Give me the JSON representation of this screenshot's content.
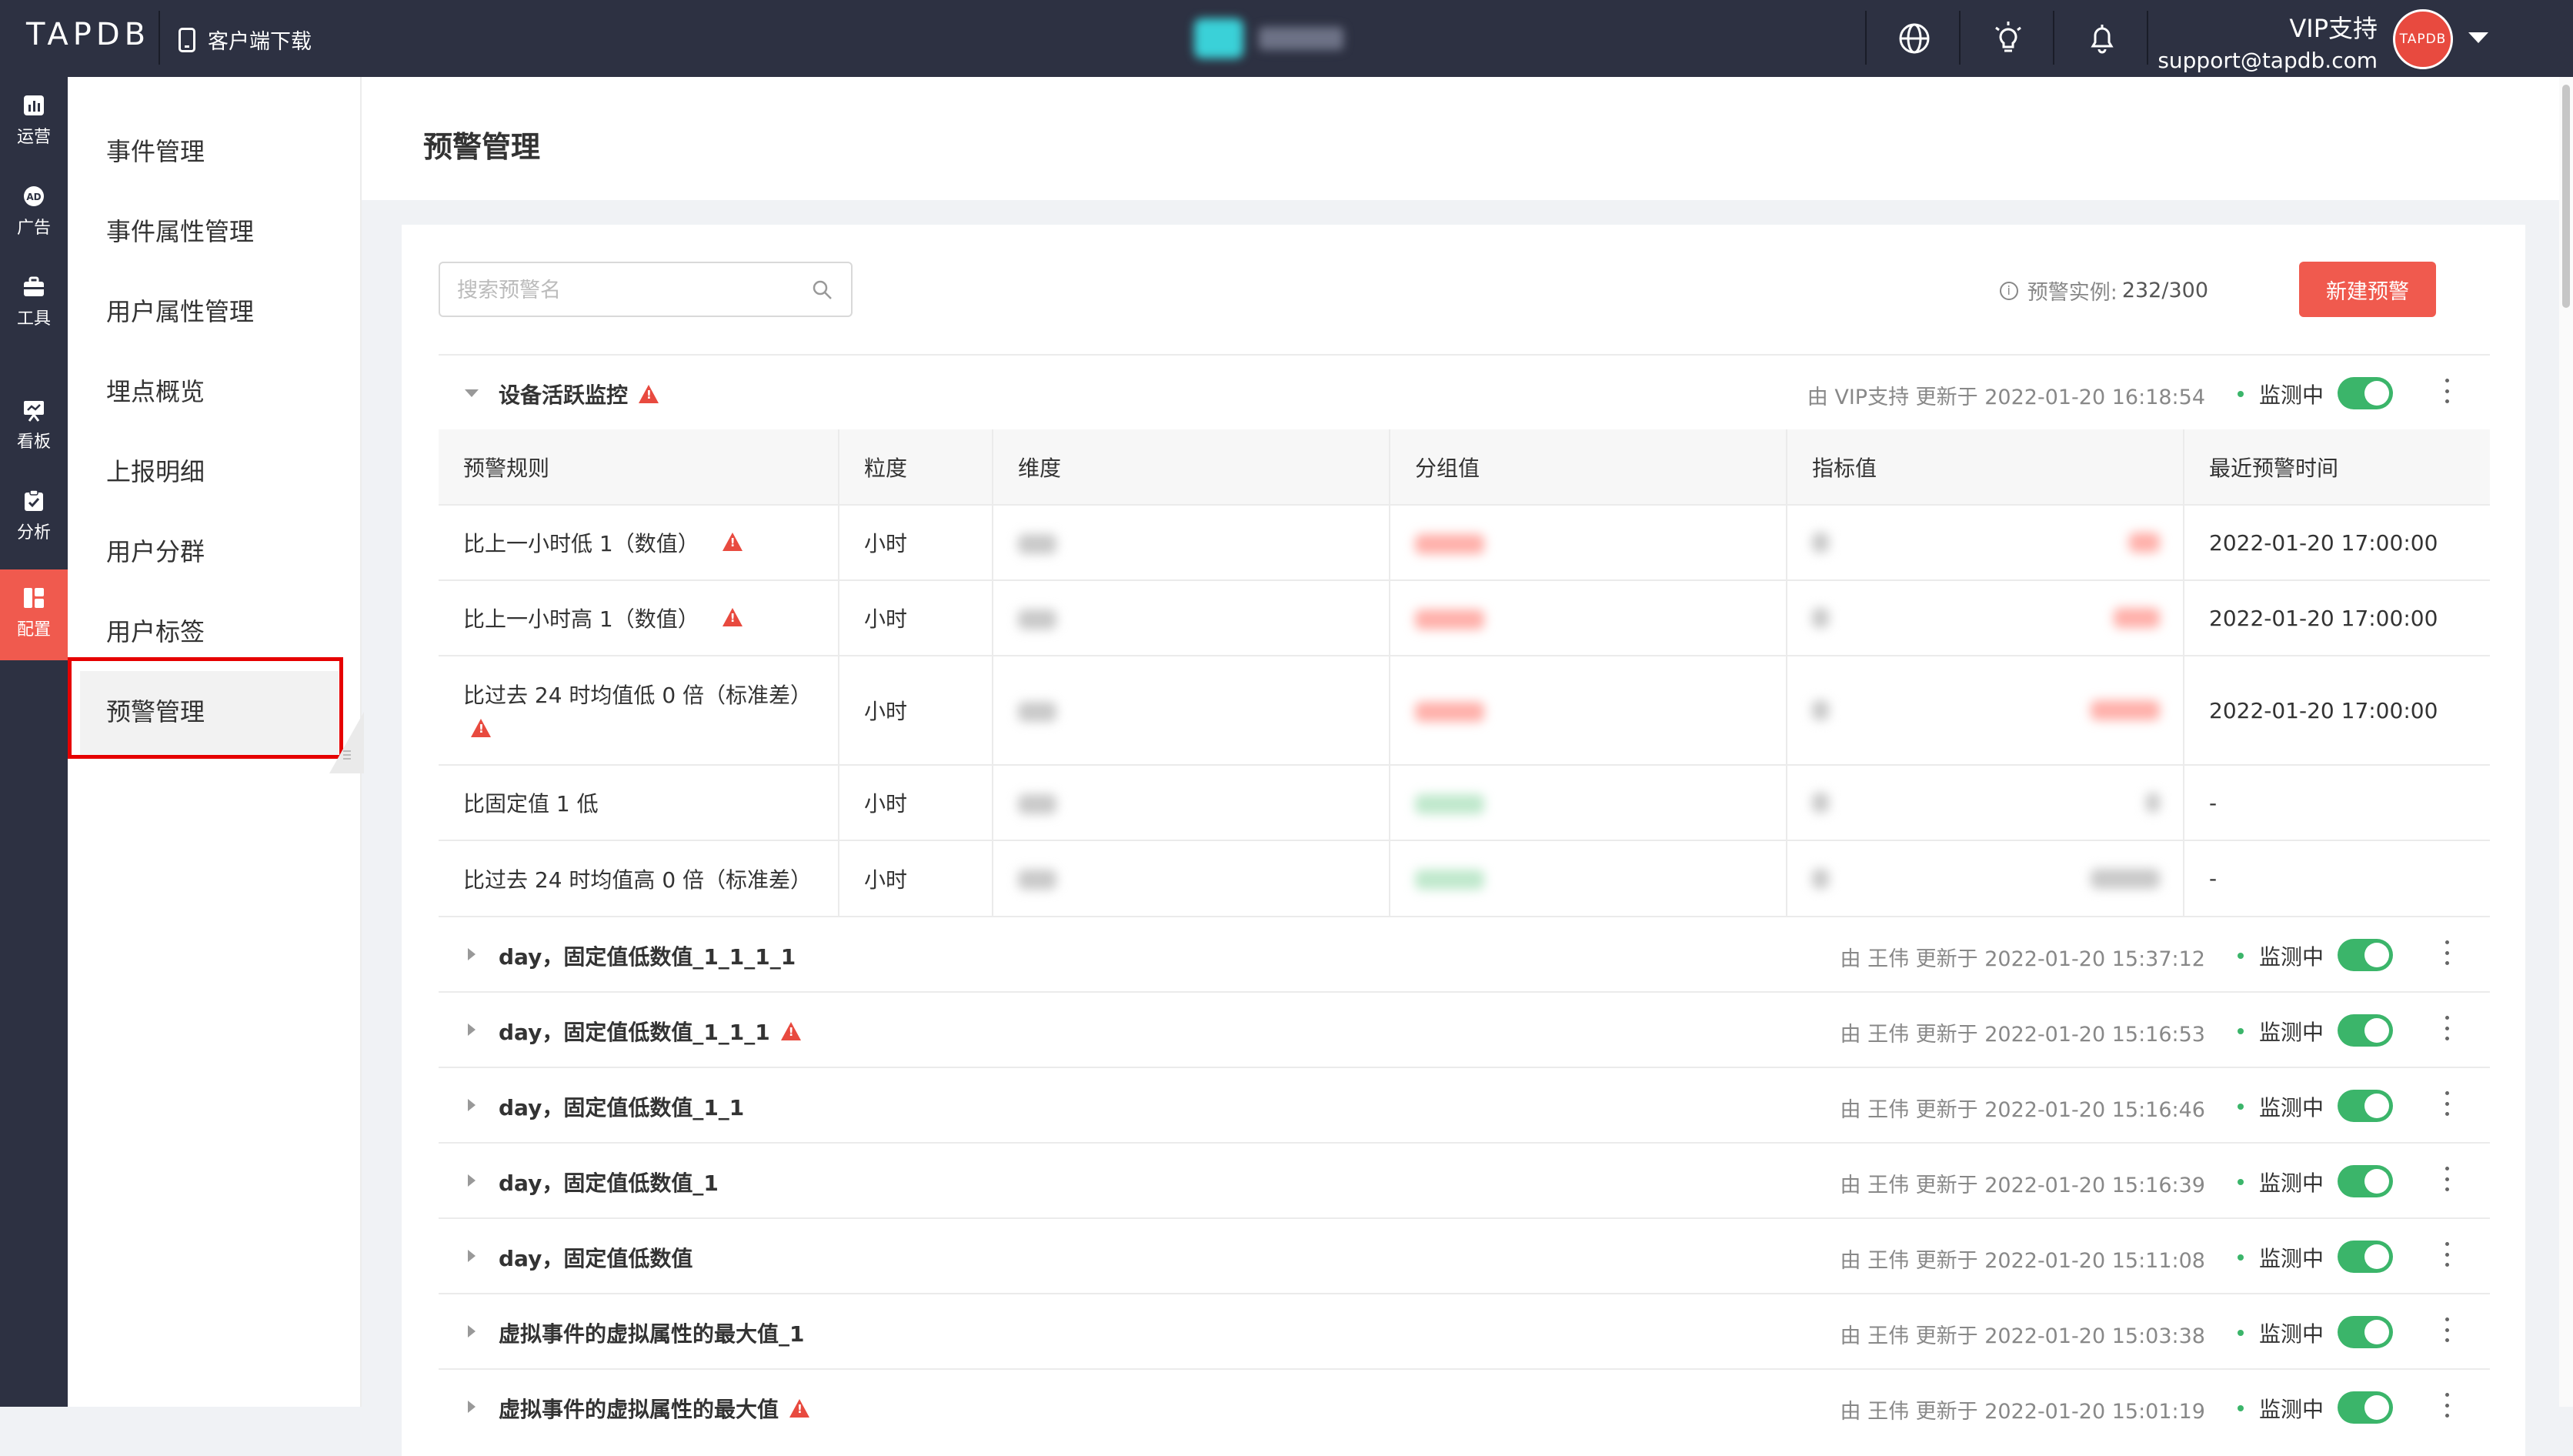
{
  "topbar": {
    "logo": "TAPDB",
    "download_label": "客户端下载",
    "user_role": "VIP支持",
    "user_email": "support@tapdb.com",
    "avatar_text": "TAPDB"
  },
  "rail": {
    "items": [
      {
        "label": "运营",
        "icon": "chart-icon"
      },
      {
        "label": "广告",
        "icon": "ad-icon"
      },
      {
        "label": "工具",
        "icon": "toolbox-icon"
      },
      {
        "label": "看板",
        "icon": "dashboard-icon"
      },
      {
        "label": "分析",
        "icon": "analysis-icon"
      },
      {
        "label": "配置",
        "icon": "config-icon",
        "active": true
      }
    ]
  },
  "menu": {
    "items": [
      "事件管理",
      "事件属性管理",
      "用户属性管理",
      "埋点概览",
      "上报明细",
      "用户分群",
      "用户标签",
      "预警管理"
    ],
    "active": "预警管理"
  },
  "page": {
    "title": "预警管理",
    "search_placeholder": "搜索预警名",
    "quota_label": "预警实例:",
    "quota_value": "232/300",
    "new_button": "新建预警"
  },
  "expanded_alert": {
    "name": "设备活跃监控",
    "meta": "由 VIP支持 更新于 2022-01-20 16:18:54",
    "status": "监测中",
    "columns": [
      "预警规则",
      "粒度",
      "维度",
      "分组值",
      "指标值",
      "最近预警时间"
    ],
    "rules": [
      {
        "rule": "比上一小时低 1（数值）",
        "granularity": "小时",
        "last": "2022-01-20 17:00:00"
      },
      {
        "rule": "比上一小时高 1（数值）",
        "granularity": "小时",
        "last": "2022-01-20 17:00:00"
      },
      {
        "rule": "比过去 24 时均值低 0 倍（标准差）",
        "granularity": "小时",
        "last": "2022-01-20 17:00:00"
      },
      {
        "rule": "比固定值 1 低",
        "granularity": "小时",
        "last": "-"
      },
      {
        "rule": "比过去 24 时均值高 0 倍（标准差）",
        "granularity": "小时",
        "last": "-"
      }
    ]
  },
  "alerts": [
    {
      "name": "day，固定值低数值_1_1_1_1",
      "meta": "由 王伟 更新于 2022-01-20 15:37:12",
      "status": "监测中"
    },
    {
      "name": "day，固定值低数值_1_1_1",
      "meta": "由 王伟 更新于 2022-01-20 15:16:53",
      "status": "监测中"
    },
    {
      "name": "day，固定值低数值_1_1",
      "meta": "由 王伟 更新于 2022-01-20 15:16:46",
      "status": "监测中"
    },
    {
      "name": "day，固定值低数值_1",
      "meta": "由 王伟 更新于 2022-01-20 15:16:39",
      "status": "监测中"
    },
    {
      "name": "day，固定值低数值",
      "meta": "由 王伟 更新于 2022-01-20 15:11:08",
      "status": "监测中"
    },
    {
      "name": "虚拟事件的虚拟属性的最大值_1",
      "meta": "由 王伟 更新于 2022-01-20 15:03:38",
      "status": "监测中"
    },
    {
      "name": "虚拟事件的虚拟属性的最大值",
      "meta": "由 王伟 更新于 2022-01-20 15:01:19",
      "status": "监测中"
    }
  ],
  "colors": {
    "brand_red": "#f05a4e",
    "nav_dark": "#2d3142",
    "toggle_green": "#3bb56a",
    "highlight": "#e60000"
  }
}
